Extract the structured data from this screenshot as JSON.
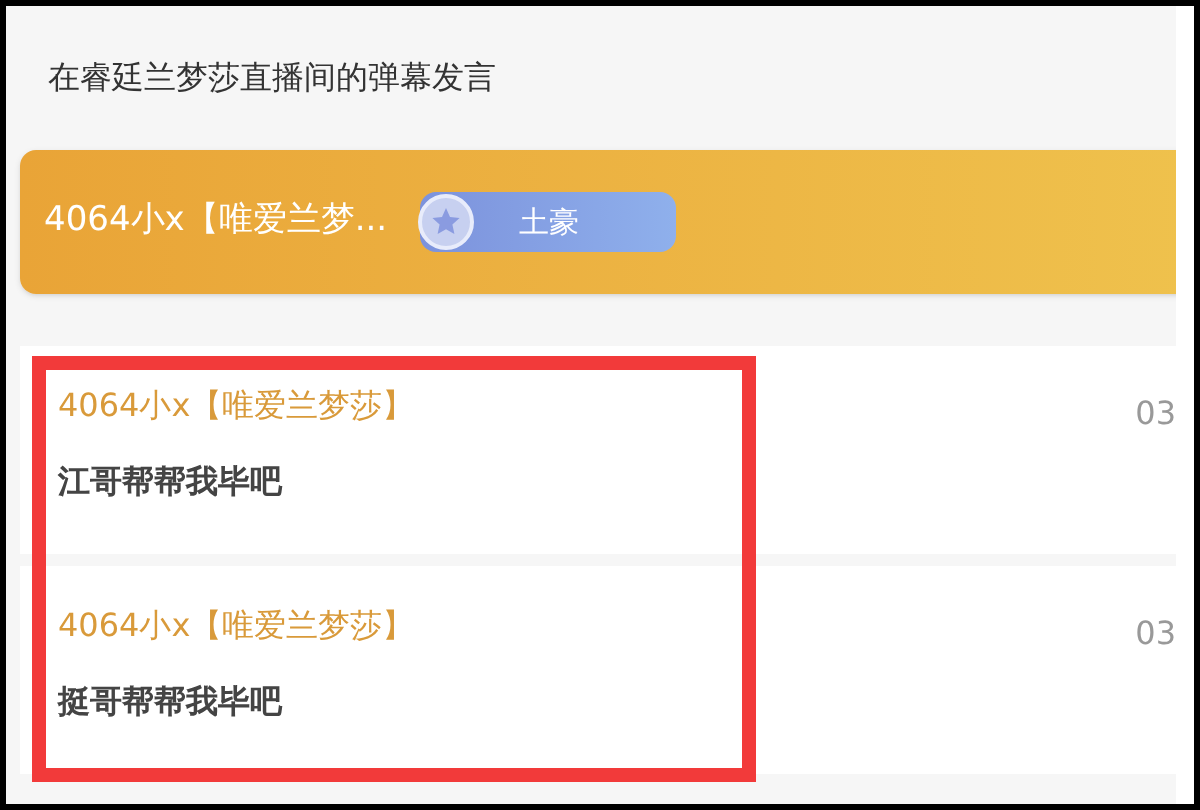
{
  "title": "在睿廷兰梦莎直播间的弹幕发言",
  "header": {
    "user": "4064小x【唯爱兰梦...",
    "badge": "土豪"
  },
  "messages": [
    {
      "user": "4064小x【唯爱兰梦莎】",
      "text": "江哥帮帮我毕吧",
      "time": "03"
    },
    {
      "user": "4064小x【唯爱兰梦莎】",
      "text": "挺哥帮帮我毕吧",
      "time": "03"
    }
  ],
  "highlight": {
    "kind": "frame",
    "color": "#f23a3a"
  }
}
